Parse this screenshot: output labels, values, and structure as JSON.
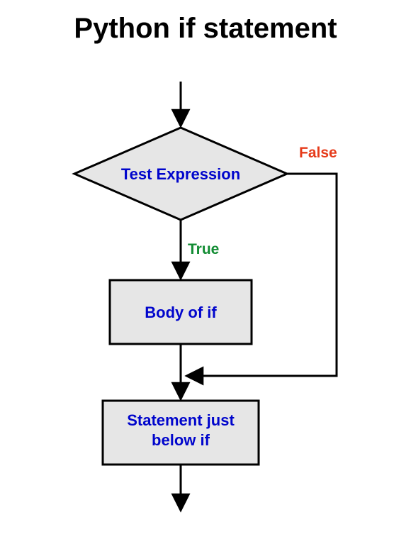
{
  "title": "Python if statement",
  "nodes": {
    "decision": "Test Expression",
    "body": "Body of if",
    "after1": "Statement just",
    "after2": "below if"
  },
  "branches": {
    "true": "True",
    "false": "False"
  },
  "style": {
    "node_fill": "#E6E6E6",
    "node_stroke": "#000000",
    "label_color": "#0005CC",
    "true_color": "#128C33",
    "false_color": "#E63B1A"
  }
}
